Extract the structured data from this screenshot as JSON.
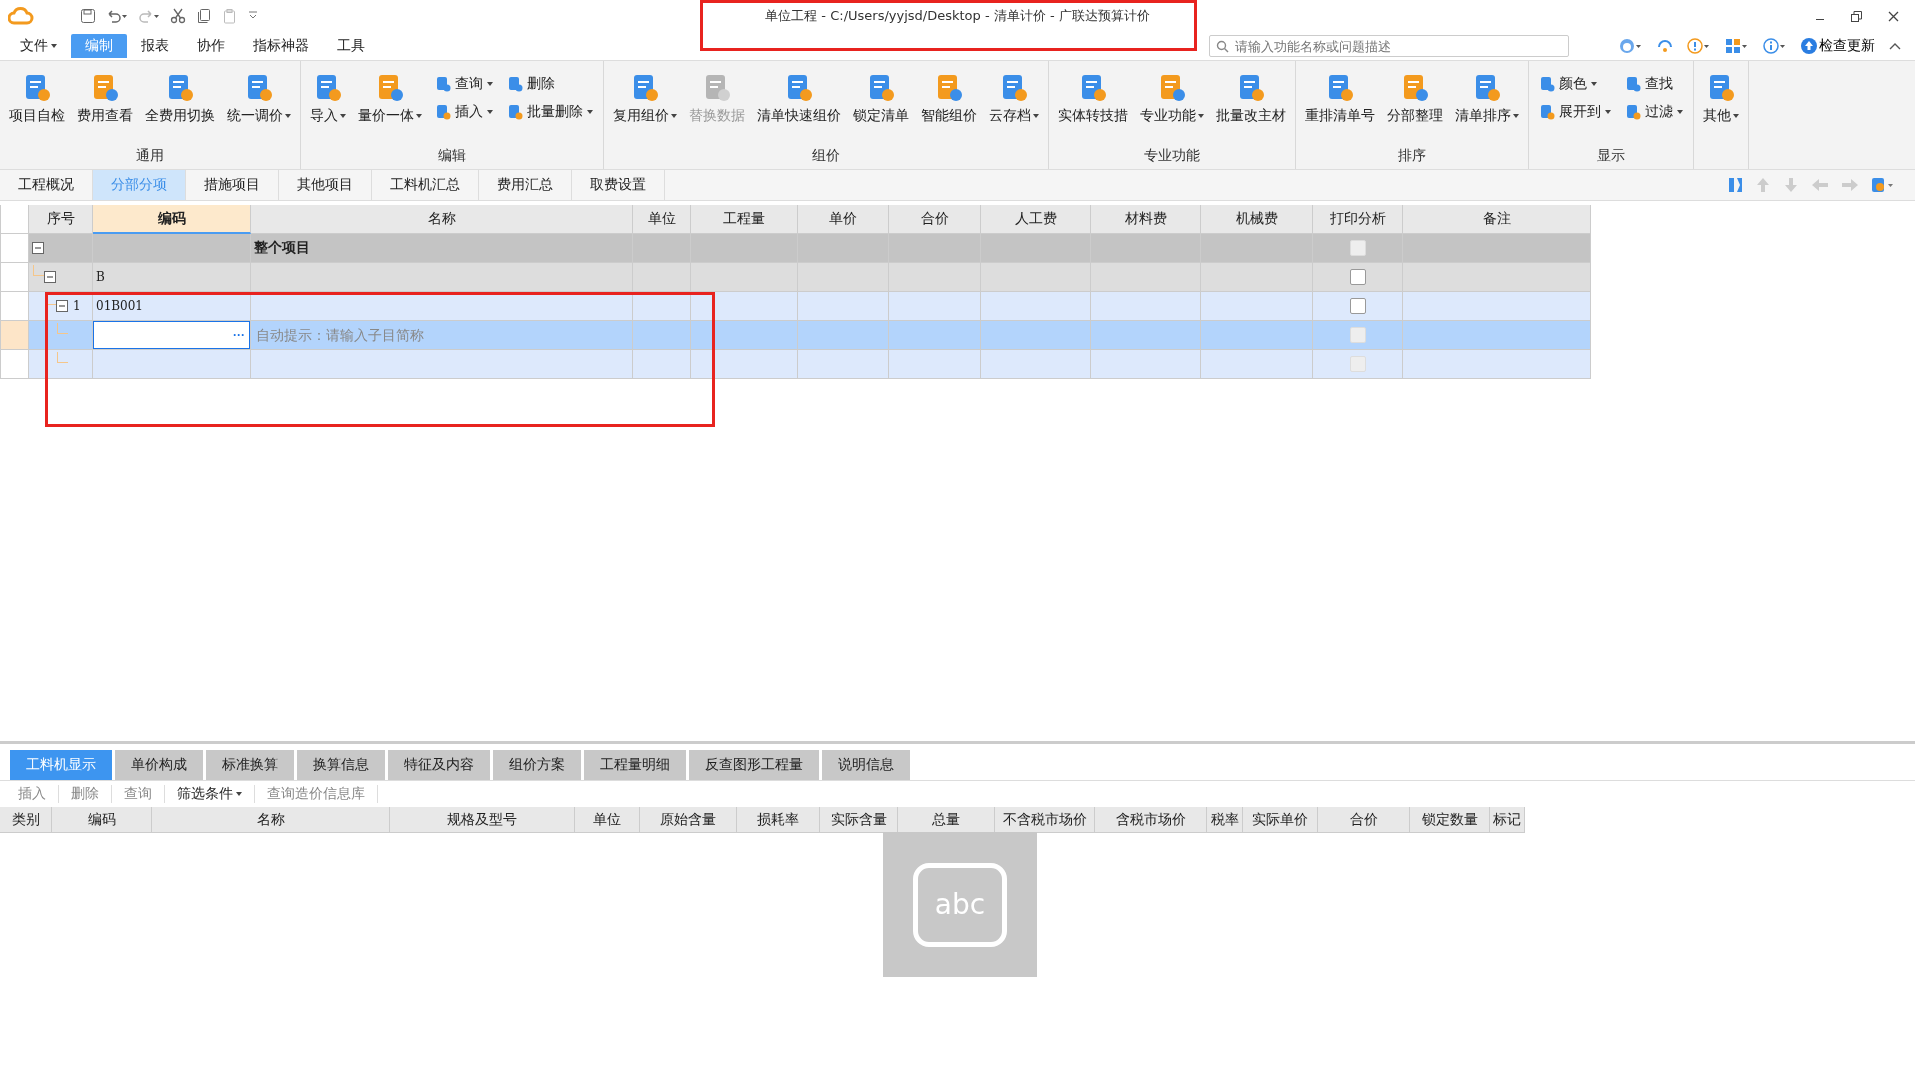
{
  "window": {
    "title": "单位工程 - C:/Users/yyjsd/Desktop - 清单计价 - 广联达预算计价"
  },
  "menu": [
    {
      "label": "文件",
      "dropdown": true,
      "selected": false
    },
    {
      "label": "编制",
      "dropdown": false,
      "selected": true
    },
    {
      "label": "报表",
      "dropdown": false,
      "selected": false
    },
    {
      "label": "协作",
      "dropdown": false,
      "selected": false
    },
    {
      "label": "指标神器",
      "dropdown": false,
      "selected": false
    },
    {
      "label": "工具",
      "dropdown": false,
      "selected": false
    }
  ],
  "search": {
    "placeholder": "请输入功能名称或问题描述"
  },
  "update_button": "检查更新",
  "ribbon": {
    "groups": [
      {
        "label": "通用",
        "items": [
          {
            "kind": "large",
            "label": "项目自检",
            "dropdown": false,
            "disabled": false
          },
          {
            "kind": "large",
            "label": "费用查看",
            "dropdown": false,
            "disabled": false
          },
          {
            "kind": "large",
            "label": "全费用切换",
            "dropdown": false,
            "disabled": false
          },
          {
            "kind": "large",
            "label": "统一调价",
            "dropdown": true,
            "disabled": false
          }
        ]
      },
      {
        "label": "编辑",
        "items": [
          {
            "kind": "large",
            "label": "导入",
            "dropdown": true,
            "disabled": false
          },
          {
            "kind": "large",
            "label": "量价一体",
            "dropdown": true,
            "disabled": false
          },
          {
            "kind": "small",
            "label": "查询",
            "dropdown": true,
            "disabled": false
          },
          {
            "kind": "small",
            "label": "插入",
            "dropdown": true,
            "disabled": false
          },
          {
            "kind": "small",
            "label": "删除",
            "dropdown": false,
            "disabled": false
          },
          {
            "kind": "small",
            "label": "批量删除",
            "dropdown": true,
            "disabled": false
          }
        ]
      },
      {
        "label": "组价",
        "items": [
          {
            "kind": "large",
            "label": "复用组价",
            "dropdown": true,
            "disabled": false
          },
          {
            "kind": "large",
            "label": "替换数据",
            "dropdown": false,
            "disabled": true
          },
          {
            "kind": "large",
            "label": "清单快速组价",
            "dropdown": false,
            "disabled": false
          },
          {
            "kind": "large",
            "label": "锁定清单",
            "dropdown": false,
            "disabled": false
          },
          {
            "kind": "large",
            "label": "智能组价",
            "dropdown": false,
            "disabled": false
          },
          {
            "kind": "large",
            "label": "云存档",
            "dropdown": true,
            "disabled": false
          }
        ]
      },
      {
        "label": "专业功能",
        "items": [
          {
            "kind": "large",
            "label": "实体转技措",
            "dropdown": false,
            "disabled": false
          },
          {
            "kind": "large",
            "label": "专业功能",
            "dropdown": true,
            "disabled": false
          },
          {
            "kind": "large",
            "label": "批量改主材",
            "dropdown": false,
            "disabled": false
          }
        ]
      },
      {
        "label": "排序",
        "items": [
          {
            "kind": "large",
            "label": "重排清单号",
            "dropdown": false,
            "disabled": false
          },
          {
            "kind": "large",
            "label": "分部整理",
            "dropdown": false,
            "disabled": false
          },
          {
            "kind": "large",
            "label": "清单排序",
            "dropdown": true,
            "disabled": false
          }
        ]
      },
      {
        "label": "显示",
        "items": [
          {
            "kind": "small",
            "label": "颜色",
            "dropdown": true,
            "disabled": false
          },
          {
            "kind": "small",
            "label": "展开到",
            "dropdown": true,
            "disabled": false
          },
          {
            "kind": "small",
            "label": "查找",
            "dropdown": false,
            "disabled": false
          },
          {
            "kind": "small",
            "label": "过滤",
            "dropdown": true,
            "disabled": false
          }
        ]
      },
      {
        "items": [
          {
            "kind": "large",
            "label": "其他",
            "dropdown": true,
            "disabled": false
          }
        ]
      }
    ]
  },
  "tabs": [
    {
      "label": "工程概况",
      "selected": false
    },
    {
      "label": "分部分项",
      "selected": true
    },
    {
      "label": "措施项目",
      "selected": false
    },
    {
      "label": "其他项目",
      "selected": false
    },
    {
      "label": "工料机汇总",
      "selected": false
    },
    {
      "label": "费用汇总",
      "selected": false
    },
    {
      "label": "取费设置",
      "selected": false
    }
  ],
  "table": {
    "columns": [
      {
        "label": "序号",
        "selected": false
      },
      {
        "label": "编码",
        "selected": true
      },
      {
        "label": "名称",
        "selected": false
      },
      {
        "label": "单位",
        "selected": false
      },
      {
        "label": "工程量",
        "selected": false
      },
      {
        "label": "单价",
        "selected": false
      },
      {
        "label": "合价",
        "selected": false
      },
      {
        "label": "人工费",
        "selected": false
      },
      {
        "label": "材料费",
        "selected": false
      },
      {
        "label": "机械费",
        "selected": false
      },
      {
        "label": "打印分析",
        "selected": false
      },
      {
        "label": "备注",
        "selected": false
      }
    ],
    "rows": [
      {
        "kind": "root",
        "name": "整个项目",
        "selected": false,
        "expanded": true,
        "print_disabled": true,
        "children": [
          {
            "kind": "group",
            "code": "B",
            "selected": false,
            "expanded": true,
            "print_disabled": false,
            "children": [
              {
                "kind": "item",
                "seq": "1",
                "code": "01B001",
                "selected": false,
                "expanded": true,
                "print_disabled": false,
                "children": [
                  {
                    "kind": "editing",
                    "more_button": "···",
                    "name_placeholder": "自动提示：请输入子目简称",
                    "selected": true,
                    "print_disabled": true
                  },
                  {
                    "kind": "empty",
                    "selected": false,
                    "print_disabled": true
                  }
                ]
              }
            ]
          }
        ]
      }
    ]
  },
  "bottom_panel": {
    "tabs": [
      {
        "label": "工料机显示",
        "selected": true
      },
      {
        "label": "单价构成",
        "selected": false
      },
      {
        "label": "标准换算",
        "selected": false
      },
      {
        "label": "换算信息",
        "selected": false
      },
      {
        "label": "特征及内容",
        "selected": false
      },
      {
        "label": "组价方案",
        "selected": false
      },
      {
        "label": "工程量明细",
        "selected": false
      },
      {
        "label": "反查图形工程量",
        "selected": false
      },
      {
        "label": "说明信息",
        "selected": false
      }
    ],
    "toolbar": [
      {
        "label": "插入",
        "dropdown": false,
        "disabled": true
      },
      {
        "label": "删除",
        "dropdown": false,
        "disabled": true
      },
      {
        "label": "查询",
        "dropdown": false,
        "disabled": true
      },
      {
        "label": "筛选条件",
        "dropdown": true,
        "disabled": false
      },
      {
        "label": "查询造价信息库",
        "dropdown": false,
        "disabled": true
      }
    ],
    "columns": [
      "类别",
      "编码",
      "名称",
      "规格及型号",
      "单位",
      "原始含量",
      "损耗率",
      "实际含量",
      "总量",
      "不含税市场价",
      "含税市场价",
      "税率",
      "实际单价",
      "合价",
      "锁定数量",
      "标记"
    ]
  },
  "ime_popup": {
    "label": "abc"
  }
}
